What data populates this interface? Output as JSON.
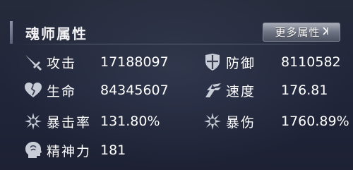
{
  "panel": {
    "title": "魂师属性",
    "more_button": "更多属性"
  },
  "stats": {
    "attack": {
      "label": "攻击",
      "value": "17188097",
      "icon": "sword-icon"
    },
    "defense": {
      "label": "防御",
      "value": "8110582",
      "icon": "shield-icon"
    },
    "hp": {
      "label": "生命",
      "value": "84345607",
      "icon": "heart-icon"
    },
    "speed": {
      "label": "速度",
      "value": "176.81",
      "icon": "wing-icon"
    },
    "crit_rate": {
      "label": "暴击率",
      "value": "131.80%",
      "icon": "starburst-icon"
    },
    "crit_damage": {
      "label": "暴伤",
      "value": "1760.89%",
      "icon": "starburst-icon"
    },
    "spirit": {
      "label": "精神力",
      "value": "181",
      "icon": "head-icon"
    }
  },
  "colors": {
    "text": "#ffffff",
    "icon": "#c8ccd6",
    "background": "#20253a"
  }
}
